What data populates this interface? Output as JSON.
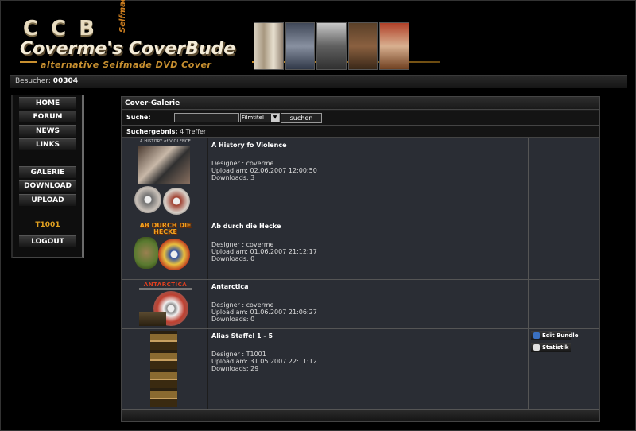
{
  "header": {
    "logo_ccb": "CCB",
    "logo_main": "Coverme's CoverBude",
    "logo_selfmade": "Selfmade",
    "logo_sub": "alternative Selfmade DVD Cover"
  },
  "visitor": {
    "label": "Besucher:",
    "count": "00304"
  },
  "nav": {
    "home": "HOME",
    "forum": "FORUM",
    "news": "NEWS",
    "links": "LINKS",
    "galerie": "GALERIE",
    "download": "DOWNLOAD",
    "upload": "UPLOAD",
    "user": "T1001",
    "logout": "LOGOUT"
  },
  "gallery": {
    "title": "Cover-Galerie",
    "search_label": "Suche:",
    "search_value": "",
    "search_field_option": "Filmtitel",
    "search_button": "suchen",
    "result_label": "Suchergebnis:",
    "result_count": "4 Treffer",
    "items": [
      {
        "title": "A History fo Violence",
        "thumb_caption": "A HISTORY of VIOLENCE",
        "designer": "Designer : coverme",
        "upload": "Upload am: 02.06.2007 12:00:50",
        "downloads": "Downloads: 3"
      },
      {
        "title": "Ab durch die Hecke",
        "thumb_caption": "AB DURCH DIE HECKE",
        "designer": "Designer : coverme",
        "upload": "Upload am: 01.06.2007 21:12:17",
        "downloads": "Downloads: 0"
      },
      {
        "title": "Antarctica",
        "thumb_caption": "ANTARCTICA",
        "designer": "Designer : coverme",
        "upload": "Upload am: 01.06.2007 21:06:27",
        "downloads": "Downloads: 0"
      },
      {
        "title": "Alias Staffel 1 - 5",
        "designer": "Designer : T1001",
        "upload": "Upload am: 31.05.2007 22:11:12",
        "downloads": "Downloads: 29",
        "action_edit": "Edit Bundle",
        "action_stats": "Statistik"
      }
    ]
  },
  "colors": {
    "accent": "#e0a020",
    "panel_bg": "#2a2d34"
  }
}
